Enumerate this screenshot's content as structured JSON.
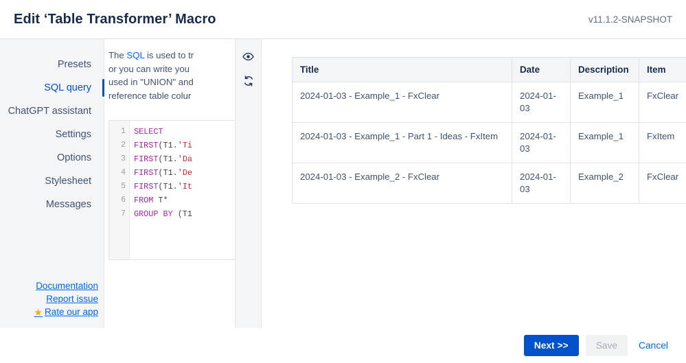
{
  "header": {
    "title": "Edit ‘Table Transformer’ Macro",
    "version": "v11.1.2-SNAPSHOT"
  },
  "sidebar": {
    "items": [
      {
        "label": "Presets",
        "active": false
      },
      {
        "label": "SQL query",
        "active": true
      },
      {
        "label": "ChatGPT assistant",
        "active": false
      },
      {
        "label": "Settings",
        "active": false
      },
      {
        "label": "Options",
        "active": false
      },
      {
        "label": "Stylesheet",
        "active": false
      },
      {
        "label": "Messages",
        "active": false
      }
    ],
    "links": [
      {
        "label": "Documentation",
        "icon": ""
      },
      {
        "label": "Report issue",
        "icon": ""
      },
      {
        "label": "Rate our app",
        "icon": "star-icon"
      }
    ],
    "star_glyph": "★"
  },
  "editor": {
    "description": {
      "prefix": "The ",
      "link": "SQL",
      "line1_rest": " is used to tr",
      "line2": "or you can write you",
      "line3": "used in \"UNION\" and",
      "line4": "reference table colur"
    },
    "line_numbers": [
      "1",
      "2",
      "3",
      "4",
      "5",
      "6",
      "7"
    ],
    "code": [
      {
        "n": "1",
        "tokens": [
          {
            "t": "SELECT",
            "c": "kw"
          }
        ]
      },
      {
        "n": "2",
        "tokens": [
          {
            "t": "FIRST",
            "c": "kw"
          },
          {
            "t": "(",
            "c": "pn"
          },
          {
            "t": "T1.",
            "c": "pn"
          },
          {
            "t": "'Ti",
            "c": "str"
          }
        ]
      },
      {
        "n": "3",
        "tokens": [
          {
            "t": "FIRST",
            "c": "kw"
          },
          {
            "t": "(",
            "c": "pn"
          },
          {
            "t": "T1.",
            "c": "pn"
          },
          {
            "t": "'Da",
            "c": "str"
          }
        ]
      },
      {
        "n": "4",
        "tokens": [
          {
            "t": "FIRST",
            "c": "kw"
          },
          {
            "t": "(",
            "c": "pn"
          },
          {
            "t": "T1.",
            "c": "pn"
          },
          {
            "t": "'De",
            "c": "str"
          }
        ]
      },
      {
        "n": "5",
        "tokens": [
          {
            "t": "FIRST",
            "c": "kw"
          },
          {
            "t": "(",
            "c": "pn"
          },
          {
            "t": "T1.",
            "c": "pn"
          },
          {
            "t": "'It",
            "c": "str"
          }
        ]
      },
      {
        "n": "6",
        "tokens": [
          {
            "t": "FROM",
            "c": "kw"
          },
          {
            "t": " T*",
            "c": "pn"
          }
        ]
      },
      {
        "n": "7",
        "tokens": [
          {
            "t": "GROUP BY",
            "c": "kw"
          },
          {
            "t": " (T1",
            "c": "pn"
          }
        ]
      }
    ]
  },
  "toolstrip": {
    "buttons": [
      {
        "name": "preview-eye-icon",
        "title": "Preview"
      },
      {
        "name": "refresh-icon",
        "title": "Refresh"
      }
    ]
  },
  "preview": {
    "table": {
      "columns": [
        "Title",
        "Date",
        "Description",
        "Item"
      ],
      "rows": [
        [
          "2024-01-03 - Example_1 - FxClear",
          "2024-01-03",
          "Example_1",
          "FxClear"
        ],
        [
          "2024-01-03 - Example_1 - Part 1 - Ideas - FxItem",
          "2024-01-03",
          "Example_1",
          "FxItem"
        ],
        [
          "2024-01-03 - Example_2 - FxClear",
          "2024-01-03",
          "Example_2",
          "FxClear"
        ]
      ]
    }
  },
  "footer": {
    "next_label": "Next >>",
    "save_label": "Save",
    "cancel_label": "Cancel"
  },
  "colors": {
    "accent": "#0052cc",
    "link": "#0065ff",
    "star": "#ffab00",
    "sidebar_bg": "#f4f5f7",
    "border": "#dfe1e6",
    "text": "#172b4d",
    "sql_keyword": "#a626a4",
    "sql_string": "#c2293a"
  }
}
